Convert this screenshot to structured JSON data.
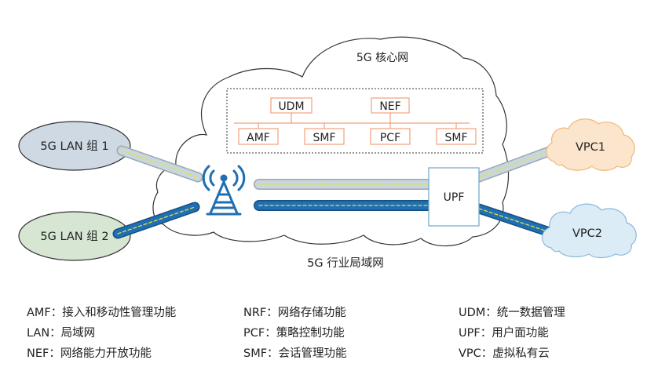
{
  "diagram": {
    "core_title": "5G 核心网",
    "industry_lan_label": "5G 行业局域网",
    "lan_group_1": "5G LAN 组 1",
    "lan_group_2": "5G LAN 组 2",
    "vpc1": "VPC1",
    "vpc2": "VPC2",
    "upf": "UPF",
    "nf": {
      "udm": "UDM",
      "nef": "NEF",
      "amf": "AMF",
      "smf_1": "SMF",
      "pcf": "PCF",
      "smf_2": "SMF"
    },
    "colors": {
      "nf_border": "#f2a07b",
      "pipe_light": "#c8d6de",
      "pipe_dark": "#1f6fb2",
      "pipe_dash": "#e8e04a",
      "antenna": "#1f6fb2",
      "lan1_fill": "#cfd9e4",
      "lan2_fill": "#d6e6d3",
      "vpc1_fill": "#fbe5cc",
      "vpc1_stroke": "#f0b777",
      "vpc2_fill": "#dcecf7",
      "vpc2_stroke": "#89b7dc"
    }
  },
  "legend": {
    "col1": [
      "AMF：接入和移动性管理功能",
      "LAN：局域网",
      "NEF：网络能力开放功能"
    ],
    "col2": [
      "NRF：网络存储功能",
      "PCF：策略控制功能",
      "SMF：会话管理功能"
    ],
    "col3": [
      "UDM：统一数据管理",
      "UPF：用户面功能",
      "VPC：虚拟私有云"
    ]
  }
}
